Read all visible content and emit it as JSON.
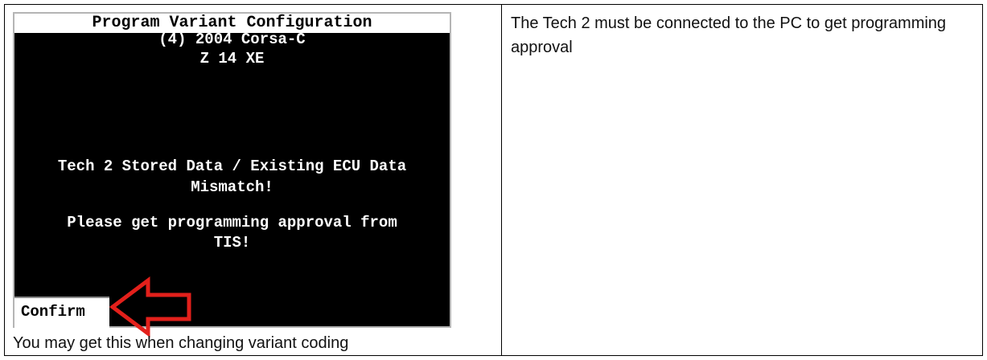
{
  "screen": {
    "title": "Program Variant Configuration",
    "vehicle_line": "(4) 2004 Corsa-C",
    "engine_line": "Z 14 XE",
    "message_line1": "Tech 2 Stored Data / Existing ECU Data",
    "message_line2": "Mismatch!",
    "message_line3": "Please get programming approval from",
    "message_line4": "TIS!",
    "softkey_label": "Confirm"
  },
  "captions": {
    "left": "You may get this when changing variant coding",
    "right": "The Tech 2 must be connected to the PC to get programming approval"
  },
  "colors": {
    "screen_background": "#000000",
    "screen_text": "#ffffff",
    "arrow": "#e3201b"
  }
}
